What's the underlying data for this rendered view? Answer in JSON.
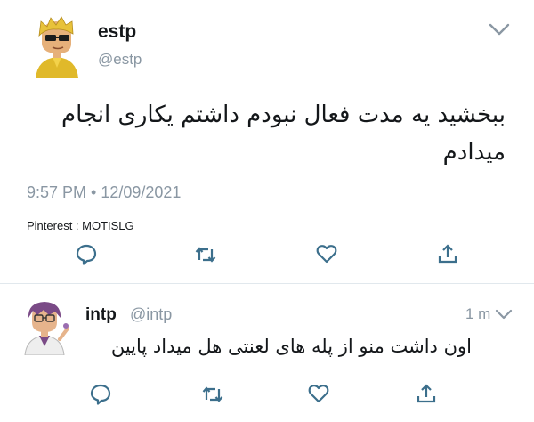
{
  "tweets": [
    {
      "name": "estp",
      "handle": "@estp",
      "text": "ببخشید یه مدت فعال نبودم داشتم یکاری انجام میدادم",
      "timestamp": "9:57 PM • 12/09/2021",
      "watermark": "Pinterest : MOTISLG",
      "avatar": "sunglasses-character-avatar"
    },
    {
      "name": "intp",
      "handle": "@intp",
      "time_ago": "1 m",
      "text": "اون داشت منو از پله های لعنتی هل میداد پایین",
      "avatar": "scientist-character-avatar"
    }
  ],
  "icons": [
    "chevron-down-icon",
    "reply-icon",
    "retweet-icon",
    "like-icon",
    "share-icon"
  ],
  "colors": {
    "text": "#14171a",
    "muted": "#8a97a3",
    "divider": "#e1e8ed",
    "icon": "#3c6f8c"
  }
}
